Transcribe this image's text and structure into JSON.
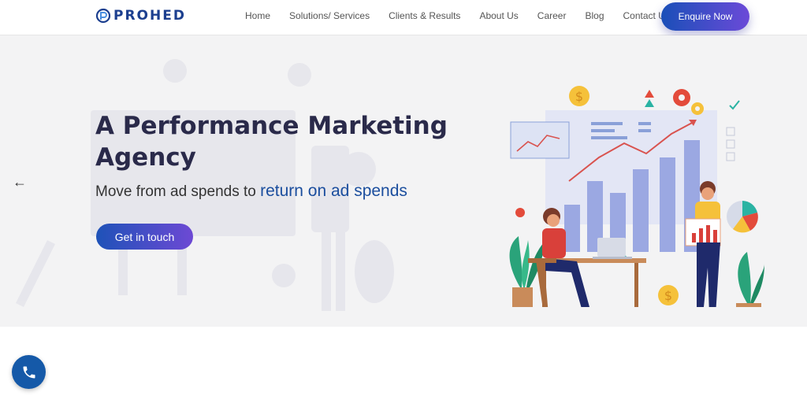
{
  "header": {
    "logo_text": "PROHED",
    "nav": [
      "Home",
      "Solutions/ Services",
      "Clients & Results",
      "About Us",
      "Career",
      "Blog",
      "Contact Us"
    ],
    "enquire_label": "Enquire Now"
  },
  "hero": {
    "title": "A Performance Marketing Agency",
    "subtitle_prefix": "Move from ad spends to",
    "subtitle_highlight": "return on ad spends",
    "cta_label": "Get in touch"
  },
  "icons": {
    "prev": "arrow-left-icon",
    "call": "phone-icon"
  },
  "colors": {
    "brand_blue": "#1c3f8f",
    "gradient_start": "#1a4fb8",
    "gradient_end": "#6b4ad8",
    "highlight_text": "#1b4e9e",
    "hero_bg": "#f3f3f4",
    "call_button": "#1559a8"
  }
}
